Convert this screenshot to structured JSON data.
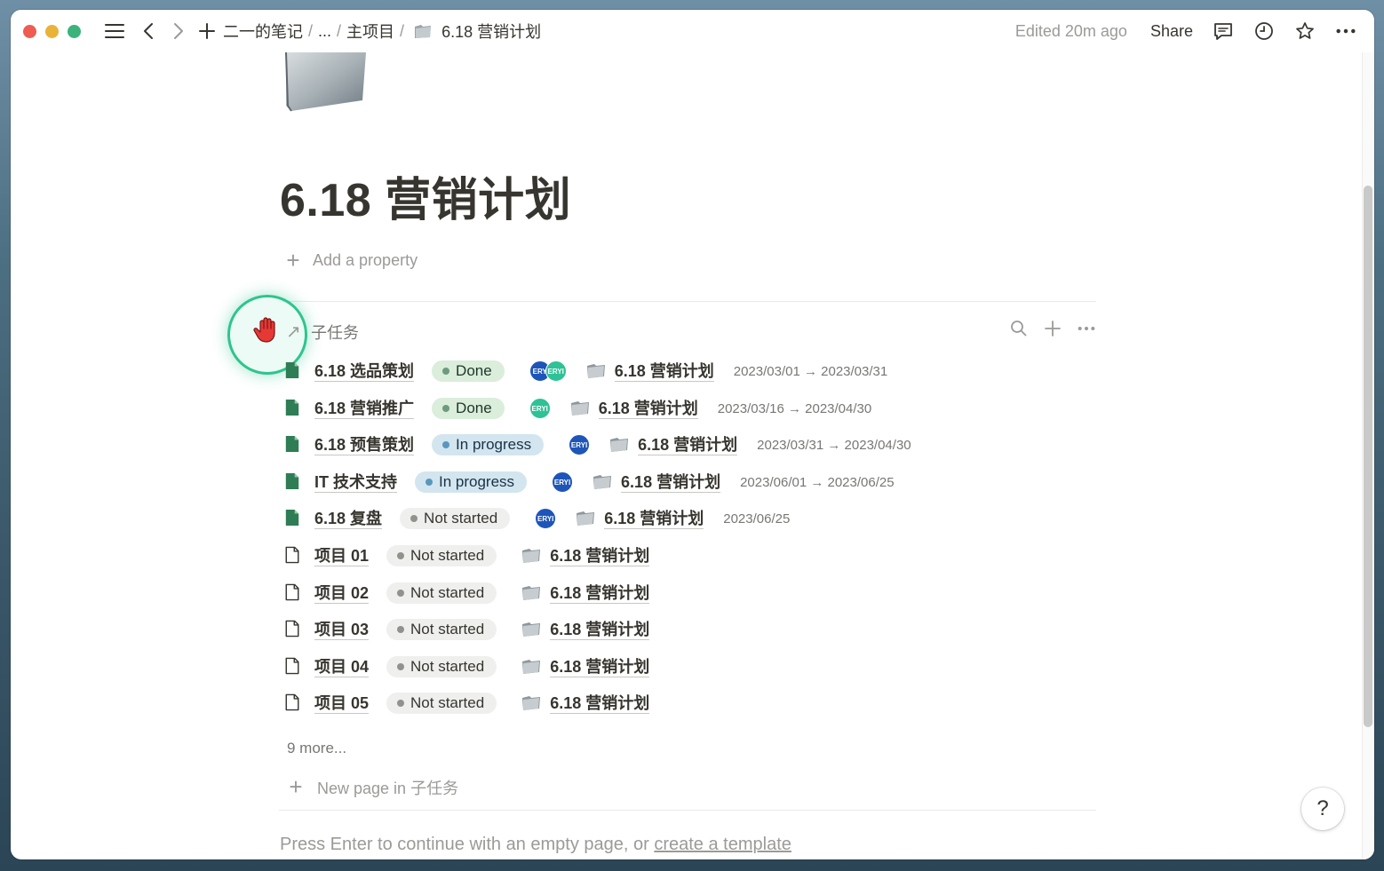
{
  "topbar": {
    "breadcrumb": [
      "二一的笔记",
      "...",
      "主项目",
      "6.18 营销计划"
    ],
    "edited": "Edited 20m ago",
    "share": "Share",
    "icons": [
      "menu-icon",
      "back-icon",
      "forward-icon",
      "plus-icon",
      "comment-icon",
      "clock-icon",
      "star-icon",
      "more-icon"
    ]
  },
  "page": {
    "title": "6.18 营销计划",
    "add_property": "Add a property"
  },
  "database": {
    "title": "子任务",
    "rows": [
      {
        "title": "6.18 选品策划",
        "filled": true,
        "status": "Done",
        "status_type": "done",
        "avatars": [
          "ERY",
          "ERYI"
        ],
        "relation": "6.18 营销计划",
        "date": "2023/03/01 → 2023/03/31"
      },
      {
        "title": "6.18 营销推广",
        "filled": true,
        "status": "Done",
        "status_type": "done",
        "avatars": [
          "ERYI"
        ],
        "relation": "6.18 营销计划",
        "date": "2023/03/16 → 2023/04/30"
      },
      {
        "title": "6.18 预售策划",
        "filled": true,
        "status": "In progress",
        "status_type": "prog",
        "avatars": [
          "ERYI"
        ],
        "relation": "6.18 营销计划",
        "date": "2023/03/31 → 2023/04/30"
      },
      {
        "title": "IT 技术支持",
        "filled": true,
        "status": "In progress",
        "status_type": "prog",
        "avatars": [
          "ERYI"
        ],
        "relation": "6.18 营销计划",
        "date": "2023/06/01 → 2023/06/25"
      },
      {
        "title": "6.18 复盘",
        "filled": true,
        "status": "Not started",
        "status_type": "not",
        "avatars": [
          "ERYI"
        ],
        "relation": "6.18 营销计划",
        "date": "2023/06/25"
      },
      {
        "title": "项目 01",
        "filled": false,
        "status": "Not started",
        "status_type": "not",
        "avatars": [],
        "relation": "6.18 营销计划",
        "date": ""
      },
      {
        "title": "项目 02",
        "filled": false,
        "status": "Not started",
        "status_type": "not",
        "avatars": [],
        "relation": "6.18 营销计划",
        "date": ""
      },
      {
        "title": "项目 03",
        "filled": false,
        "status": "Not started",
        "status_type": "not",
        "avatars": [],
        "relation": "6.18 营销计划",
        "date": ""
      },
      {
        "title": "项目 04",
        "filled": false,
        "status": "Not started",
        "status_type": "not",
        "avatars": [],
        "relation": "6.18 营销计划",
        "date": ""
      },
      {
        "title": "项目 05",
        "filled": false,
        "status": "Not started",
        "status_type": "not",
        "avatars": [],
        "relation": "6.18 营销计划",
        "date": ""
      }
    ],
    "more": "9 more...",
    "new_page": "New page in 子任务"
  },
  "hint": {
    "prefix": "Press Enter to continue with an empty page, or ",
    "link": "create a template"
  },
  "help": "?",
  "colors": {
    "done_bg": "#dbeddb",
    "progress_bg": "#d3e5ef",
    "not_started_bg": "#efefee",
    "avatar_blue": "#1e55b8",
    "avatar_green": "#2ec296",
    "highlight_ring": "#2fc48e",
    "doc_icon_green": "#2e7d54"
  }
}
